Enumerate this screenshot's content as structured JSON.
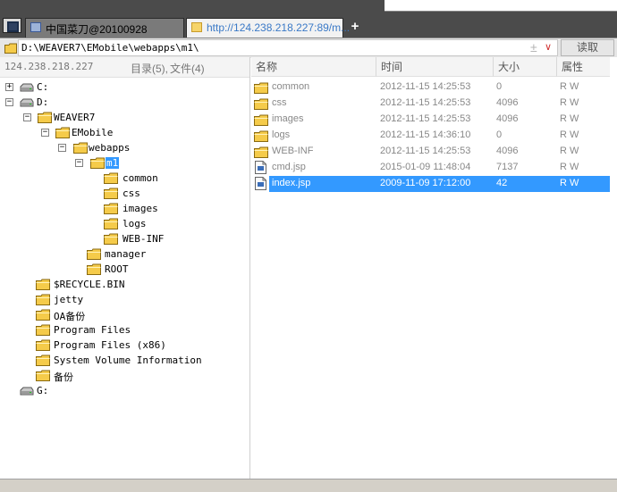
{
  "tabs": [
    {
      "label": "中国菜刀@20100928"
    },
    {
      "label": "http://124.238.218.227:89/m..."
    }
  ],
  "new_tab_icon": "plus-icon",
  "address": {
    "value": "D:\\WEAVER7\\EMobile\\webapps\\m1\\",
    "plus_glyph": "±",
    "dropdown_glyph": "∨",
    "read_button": "读取"
  },
  "left": {
    "ip": "124.238.218.227",
    "dir_label": "目录(5),",
    "file_label": "文件(4)"
  },
  "tree": [
    {
      "label": "C:",
      "kind": "drive",
      "expander": "+"
    },
    {
      "label": "D:",
      "kind": "drive",
      "expander": "−"
    },
    {
      "label": "WEAVER7",
      "kind": "folder",
      "expander": "−"
    },
    {
      "label": "EMobile",
      "kind": "folder",
      "expander": "−"
    },
    {
      "label": "webapps",
      "kind": "folder",
      "expander": "−"
    },
    {
      "label": "m1",
      "kind": "folder",
      "expander": "−",
      "selected": true
    },
    {
      "label": "common",
      "kind": "folder"
    },
    {
      "label": "css",
      "kind": "folder"
    },
    {
      "label": "images",
      "kind": "folder"
    },
    {
      "label": "logs",
      "kind": "folder"
    },
    {
      "label": "WEB-INF",
      "kind": "folder"
    },
    {
      "label": "manager",
      "kind": "folder"
    },
    {
      "label": "ROOT",
      "kind": "folder"
    },
    {
      "label": "$RECYCLE.BIN",
      "kind": "folder"
    },
    {
      "label": "jetty",
      "kind": "folder"
    },
    {
      "label": "OA备份",
      "kind": "folder"
    },
    {
      "label": "Program Files",
      "kind": "folder"
    },
    {
      "label": "Program Files (x86)",
      "kind": "folder"
    },
    {
      "label": "System Volume Information",
      "kind": "folder"
    },
    {
      "label": "备份",
      "kind": "folder"
    },
    {
      "label": "G:",
      "kind": "drive"
    }
  ],
  "columns": {
    "name": "名称",
    "time": "时间",
    "size": "大小",
    "attr": "属性"
  },
  "files": [
    {
      "name": "common",
      "time": "2012-11-15 14:25:53",
      "size": "0",
      "attr": "R W",
      "icon": "folder-icon"
    },
    {
      "name": "css",
      "time": "2012-11-15 14:25:53",
      "size": "4096",
      "attr": "R W",
      "icon": "folder-icon"
    },
    {
      "name": "images",
      "time": "2012-11-15 14:25:53",
      "size": "4096",
      "attr": "R W",
      "icon": "folder-icon"
    },
    {
      "name": "logs",
      "time": "2012-11-15 14:36:10",
      "size": "0",
      "attr": "R W",
      "icon": "folder-icon"
    },
    {
      "name": "WEB-INF",
      "time": "2012-11-15 14:25:53",
      "size": "4096",
      "attr": "R W",
      "icon": "folder-icon"
    },
    {
      "name": "cmd.jsp",
      "time": "2015-01-09 11:48:04",
      "size": "7137",
      "attr": "R W",
      "icon": "file-icon"
    },
    {
      "name": "index.jsp",
      "time": "2009-11-09 17:12:00",
      "size": "42",
      "attr": "R W",
      "icon": "file-icon",
      "selected": true
    }
  ],
  "colors": {
    "selection": "#3399ff",
    "folder": "#f5cb4a",
    "tabbar": "#4b4b4b"
  }
}
